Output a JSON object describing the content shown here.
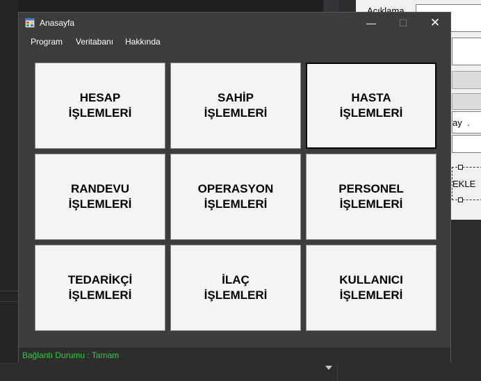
{
  "window": {
    "title": "Anasayfa",
    "controls": {
      "minimize": "—",
      "maximize": "☐",
      "close": "✕"
    }
  },
  "menu": [
    {
      "label": "Program"
    },
    {
      "label": "Veritabanı"
    },
    {
      "label": "Hakkında"
    }
  ],
  "tiles": [
    {
      "line1": "HESAP",
      "line2": "İŞLEMLERİ"
    },
    {
      "line1": "SAHİP",
      "line2": "İŞLEMLERİ"
    },
    {
      "line1": "HASTA",
      "line2": "İŞLEMLERİ"
    },
    {
      "line1": "RANDEVU",
      "line2": "İŞLEMLERİ"
    },
    {
      "line1": "OPERASYON",
      "line2": "İŞLEMLERİ"
    },
    {
      "line1": "PERSONEL",
      "line2": "İŞLEMLERİ"
    },
    {
      "line1": "TEDARİKÇİ",
      "line2": "İŞLEMLERİ"
    },
    {
      "line1": "İLAÇ",
      "line2": "İŞLEMLERİ"
    },
    {
      "line1": "KULLANICI",
      "line2": "İŞLEMLERİ"
    }
  ],
  "status": {
    "text": "Bağlantı Durumu : Tamam",
    "color": "#2ecc40"
  },
  "background_designer": {
    "label": "Açıklama",
    "field_text": "ay  .",
    "button_text": "EKLE"
  },
  "icons": {
    "app": "app-window-icon",
    "dropdown": "chevron-down-icon"
  }
}
